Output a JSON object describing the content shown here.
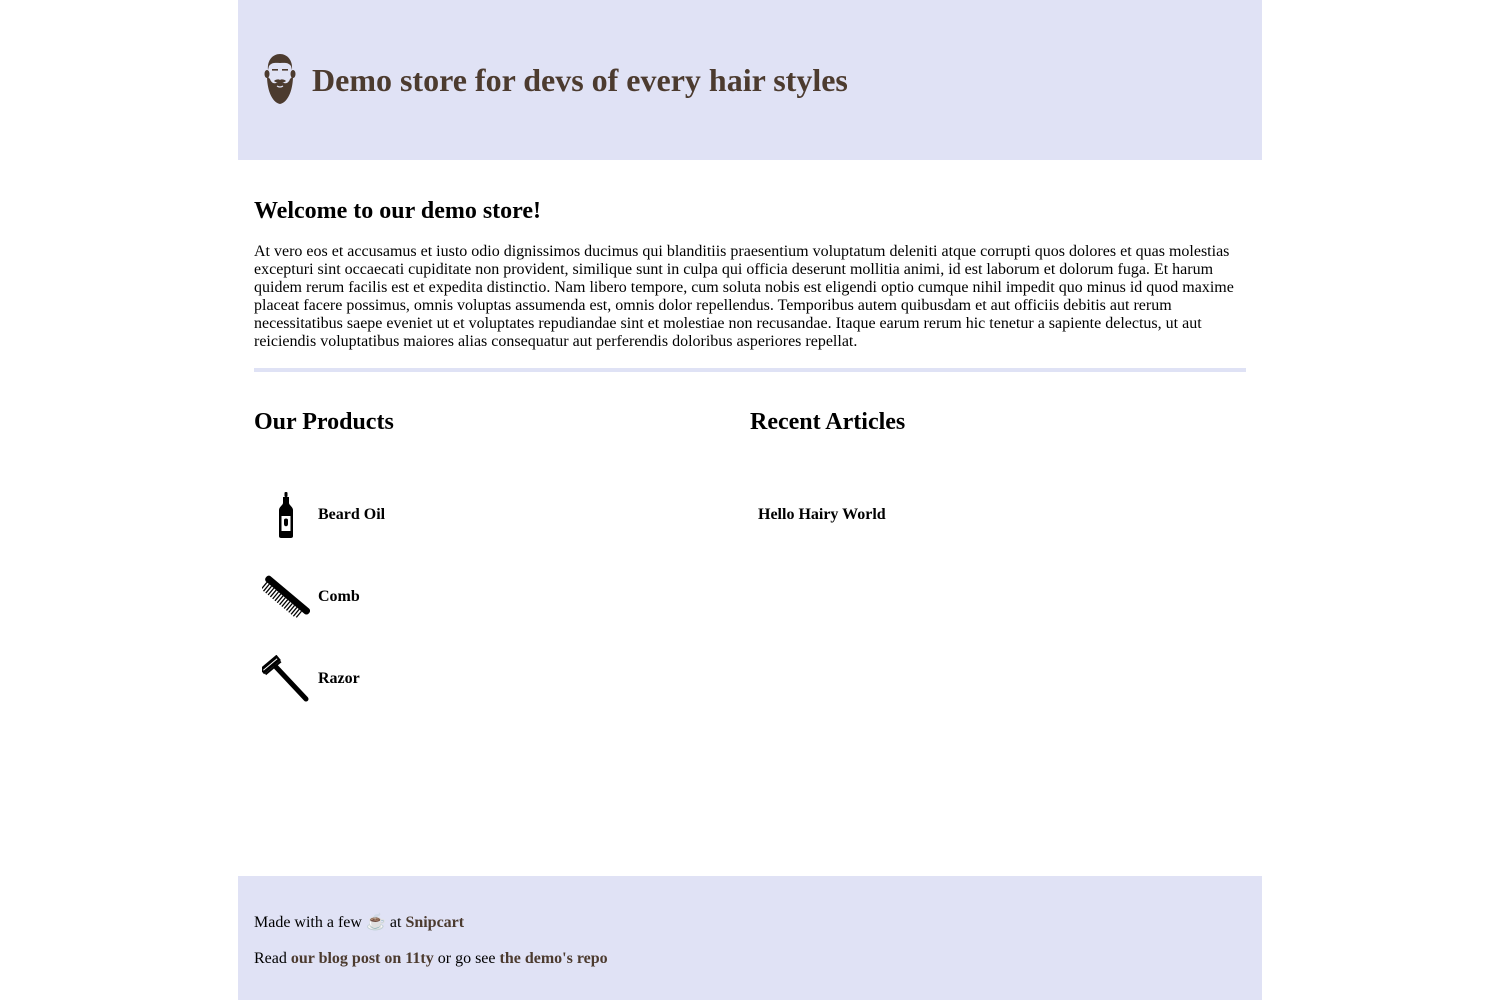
{
  "header": {
    "logo_icon": "bearded-man-icon",
    "title": "Demo store for devs of every hair styles",
    "brand_color": "#4c3b2f",
    "background": "#e0e2f5"
  },
  "welcome": {
    "title": "Welcome to our demo store!",
    "body": "At vero eos et accusamus et iusto odio dignissimos ducimus qui blanditiis praesentium voluptatum deleniti atque corrupti quos dolores et quas molestias excepturi sint occaecati cupiditate non provident, similique sunt in culpa qui officia deserunt mollitia animi, id est laborum et dolorum fuga. Et harum quidem rerum facilis est et expedita distinctio. Nam libero tempore, cum soluta nobis est eligendi optio cumque nihil impedit quo minus id quod maxime placeat facere possimus, omnis voluptas assumenda est, omnis dolor repellendus. Temporibus autem quibusdam et aut officiis debitis aut rerum necessitatibus saepe eveniet ut et voluptates repudiandae sint et molestiae non recusandae. Itaque earum rerum hic tenetur a sapiente delectus, ut aut reiciendis voluptatibus maiores alias consequatur aut perferendis doloribus asperiores repellat."
  },
  "products": {
    "title": "Our Products",
    "items": [
      {
        "name": "Beard Oil",
        "icon": "beard-oil-bottle-icon"
      },
      {
        "name": "Comb",
        "icon": "comb-icon"
      },
      {
        "name": "Razor",
        "icon": "razor-icon"
      }
    ]
  },
  "articles": {
    "title": "Recent Articles",
    "items": [
      {
        "title": "Hello Hairy World"
      }
    ]
  },
  "footer": {
    "line1_prefix": "Made with a few",
    "coffee_icon": "☕",
    "line1_mid": "at",
    "snipcart_link": "Snipcart",
    "line2_prefix": "Read",
    "blog_link": "our blog post on 11ty",
    "line2_mid": "or go see",
    "repo_link": "the demo's repo"
  }
}
